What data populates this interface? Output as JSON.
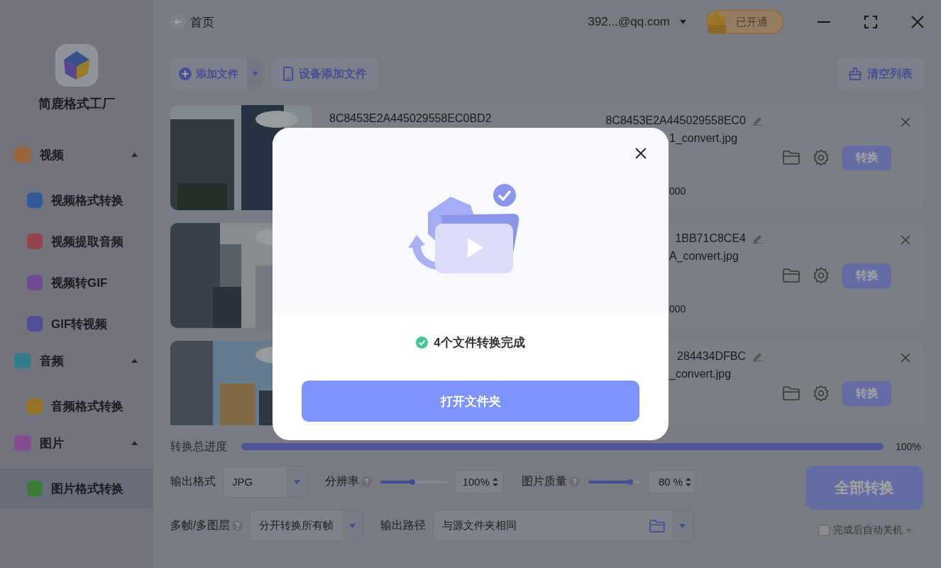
{
  "header": {
    "back": "首页",
    "account": "392...@qq.com",
    "vip": "已开通"
  },
  "sidebar": {
    "app_name": "简鹿格式工厂",
    "groups": [
      {
        "label": "视频",
        "expanded": true,
        "children": [
          {
            "label": "视频格式转换",
            "selected": false
          },
          {
            "label": "视频提取音频",
            "selected": false
          },
          {
            "label": "视频转GIF",
            "selected": false
          },
          {
            "label": "GIF转视频",
            "selected": false
          }
        ]
      },
      {
        "label": "音频",
        "expanded": true,
        "children": [
          {
            "label": "音频格式转换",
            "selected": false
          }
        ]
      },
      {
        "label": "图片",
        "expanded": true,
        "children": [
          {
            "label": "图片格式转换",
            "selected": true
          }
        ]
      }
    ]
  },
  "toolbar": {
    "add_file": "添加文件",
    "device_add": "设备添加文件",
    "clear_list": "清空列表"
  },
  "files": [
    {
      "source_name": "8C8453E2A445029558EC0BD2",
      "output_name": "8C8453E2A445029558EC0",
      "output_file": "1_convert.jpg",
      "size": "000",
      "convert": "转换"
    },
    {
      "output_name": "1BB71C8CE4",
      "output_file": "A_convert.jpg",
      "size": "000",
      "convert": "转换"
    },
    {
      "output_name": "284434DFBC",
      "output_file": "_convert.jpg",
      "convert": "转换"
    }
  ],
  "progress": {
    "label": "转换总进度",
    "level": 1,
    "reading": "100%"
  },
  "settings": {
    "format_label": "输出格式",
    "format": "JPG",
    "resolution_label": "分辨率",
    "resolution": {
      "level": 0.52,
      "value": "100%"
    },
    "quality_label": "图片质量",
    "quality": {
      "level": 0.85,
      "value": "80",
      "unit": "%"
    },
    "frames_label": "多帧/多图层",
    "frames": "分开转换所有帧",
    "path_label": "输出路径",
    "path": "与源文件夹相同",
    "convert_all": "全部转换",
    "shutdown": {
      "label": "完成后自动关机",
      "checked": false
    }
  },
  "dialog": {
    "message": "4个文件转换完成",
    "open_folder": "打开文件夹"
  }
}
